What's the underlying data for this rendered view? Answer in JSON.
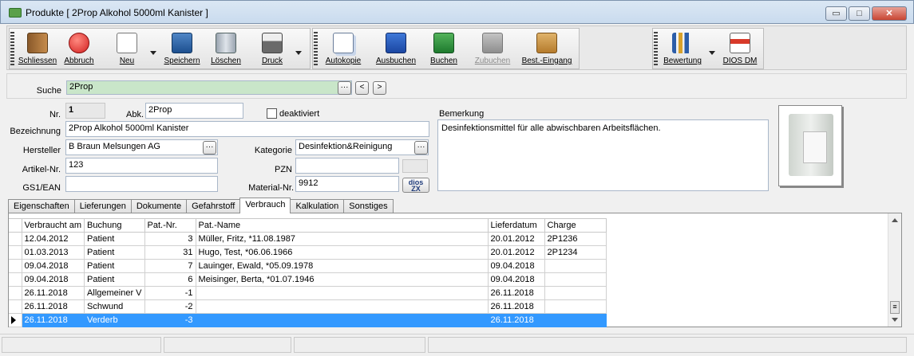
{
  "window": {
    "title": "Produkte [ 2Prop Alkohol 5000ml Kanister ]",
    "buttons": {
      "minimize": "▭",
      "maximize": "□",
      "close": "✕"
    }
  },
  "toolbar": {
    "group1": [
      {
        "label": "Schliessen",
        "icon": "door-exit-icon"
      },
      {
        "label": "Abbruch",
        "icon": "cancel-icon"
      },
      {
        "label": "Neu",
        "icon": "new-document-icon"
      },
      {
        "label": "Speichern",
        "icon": "save-icon"
      },
      {
        "label": "Löschen",
        "icon": "trash-icon"
      },
      {
        "label": "Druck",
        "icon": "printer-icon"
      }
    ],
    "group2": [
      {
        "label": "Autokopie",
        "icon": "copy-icon"
      },
      {
        "label": "Ausbuchen",
        "icon": "book-out-icon"
      },
      {
        "label": "Buchen",
        "icon": "book-icon"
      },
      {
        "label": "Zubuchen",
        "icon": "book-add-icon",
        "disabled": true
      },
      {
        "label": "Best.-Eingang",
        "icon": "box-check-icon"
      }
    ],
    "group3": [
      {
        "label": "Bewertung",
        "icon": "chart-icon"
      },
      {
        "label": "DIOS DM",
        "icon": "pdf-qm-icon"
      }
    ]
  },
  "search": {
    "label": "Suche",
    "value": "2Prop",
    "more": "···",
    "prev": "<",
    "next": ">"
  },
  "form": {
    "nr_label": "Nr.",
    "nr_value": "1",
    "abk_label": "Abk.",
    "abk_value": "2Prop",
    "deaktiviert_label": "deaktiviert",
    "bezeichnung_label": "Bezeichnung",
    "bezeichnung_value": "2Prop Alkohol 5000ml Kanister",
    "hersteller_label": "Hersteller",
    "hersteller_value": "B Braun Melsungen AG",
    "kategorie_label": "Kategorie",
    "kategorie_value": "Desinfektion&Reinigung",
    "artikel_label": "Artikel-Nr.",
    "artikel_value": "123",
    "pzn_label": "PZN",
    "pzn_value": "",
    "gs1_label": "GS1/EAN",
    "gs1_value": "",
    "material_label": "Material-Nr.",
    "material_value": "9912",
    "bemerkung_label": "Bemerkung",
    "bemerkung_value": "Desinfektionsmittel für alle abwischbaren Arbeitsflächen.",
    "dios_label_top": "dios",
    "dios_label_bottom": "ZX",
    "more": "···"
  },
  "tabs": [
    {
      "label": "Eigenschaften"
    },
    {
      "label": "Lieferungen"
    },
    {
      "label": "Dokumente"
    },
    {
      "label": "Gefahrstoff"
    },
    {
      "label": "Verbrauch",
      "active": true
    },
    {
      "label": "Kalkulation"
    },
    {
      "label": "Sonstiges"
    }
  ],
  "grid": {
    "columns": [
      "Verbraucht am",
      "Buchung",
      "Pat.-Nr.",
      "Pat.-Name",
      "Lieferdatum",
      "Charge"
    ],
    "rows": [
      [
        "12.04.2012",
        "Patient",
        "3",
        "Müller, Fritz, *11.08.1987",
        "20.01.2012",
        "2P1236"
      ],
      [
        "01.03.2013",
        "Patient",
        "31",
        "Hugo, Test, *06.06.1966",
        "20.01.2012",
        "2P1234"
      ],
      [
        "09.04.2018",
        "Patient",
        "7",
        "Lauinger, Ewald, *05.09.1978",
        "09.04.2018",
        ""
      ],
      [
        "09.04.2018",
        "Patient",
        "6",
        "Meisinger, Berta, *01.07.1946",
        "09.04.2018",
        ""
      ],
      [
        "26.11.2018",
        "Allgemeiner V",
        "-1",
        "",
        "26.11.2018",
        ""
      ],
      [
        "26.11.2018",
        "Schwund",
        "-2",
        "",
        "26.11.2018",
        ""
      ],
      [
        "26.11.2018",
        "Verderb",
        "-3",
        "",
        "26.11.2018",
        ""
      ]
    ],
    "selected_row": 6
  },
  "colors": {
    "selection": "#3399ff",
    "search_field": "#c9e6c9"
  }
}
